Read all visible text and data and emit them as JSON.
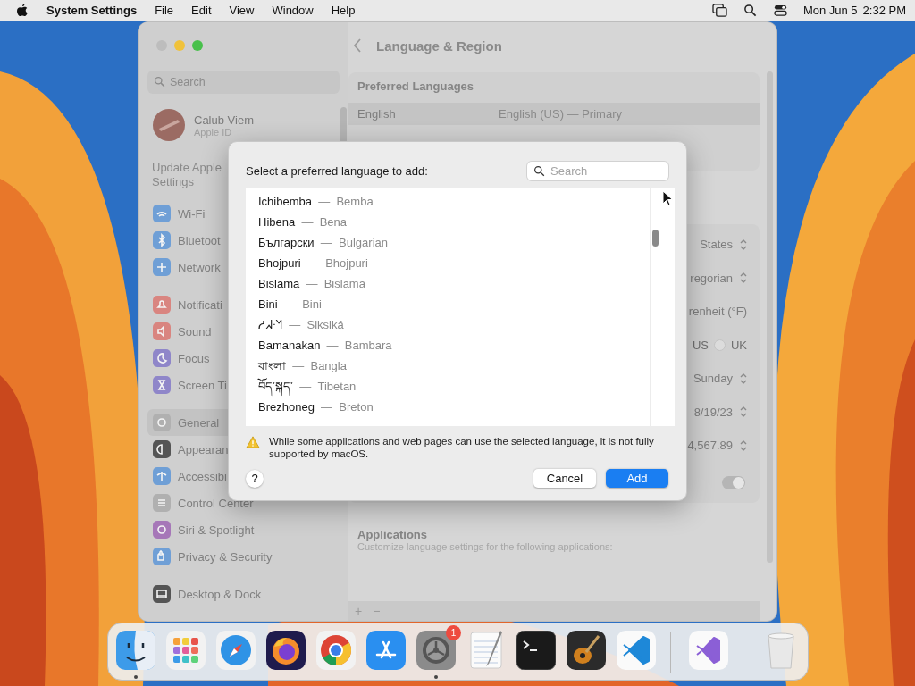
{
  "menu_bar": {
    "app": "System Settings",
    "menus": [
      "File",
      "Edit",
      "View",
      "Window",
      "Help"
    ],
    "date": "Mon Jun 5",
    "time": "2:32 PM"
  },
  "window": {
    "title": "Language & Region",
    "sidebar": {
      "search": {
        "placeholder": "Search"
      },
      "account": {
        "name": "Calub Viem",
        "subtitle": "Apple ID"
      },
      "notice": [
        "Update Apple",
        "Settings"
      ],
      "groups": [
        [
          {
            "label": "Wi-Fi",
            "color": "#6f9fd6",
            "selected": false
          },
          {
            "label": "Bluetoot",
            "color": "#6f9fd6",
            "selected": false
          },
          {
            "label": "Network",
            "color": "#6f9fd6",
            "selected": false
          }
        ],
        [
          {
            "label": "Notificati",
            "color": "#d98580",
            "selected": false
          },
          {
            "label": "Sound",
            "color": "#d98580",
            "selected": false
          },
          {
            "label": "Focus",
            "color": "#8f86c9",
            "selected": false
          },
          {
            "label": "Screen Ti",
            "color": "#8f86c9",
            "selected": false
          }
        ],
        [
          {
            "label": "General",
            "color": "#b0b0b0",
            "selected": true
          },
          {
            "label": "Appearan",
            "color": "#555555",
            "selected": false
          },
          {
            "label": "Accessibi",
            "color": "#6f9fd6",
            "selected": false
          },
          {
            "label": "Control Center",
            "color": "#b0b0b0",
            "selected": false
          },
          {
            "label": "Siri & Spotlight",
            "color": "#a677b8",
            "selected": false
          },
          {
            "label": "Privacy & Security",
            "color": "#6f9fd6",
            "selected": false
          }
        ],
        [
          {
            "label": "Desktop & Dock",
            "color": "#555555",
            "selected": false
          }
        ]
      ]
    },
    "preferred_languages": {
      "heading": "Preferred Languages",
      "rows": [
        {
          "language": "English",
          "detail": "English (US) — Primary",
          "selected": true
        }
      ]
    },
    "region_settings": [
      {
        "kind": "popup",
        "value": "States"
      },
      {
        "kind": "popup",
        "value": "regorian"
      },
      {
        "kind": "text",
        "value": "renheit (°F)"
      },
      {
        "kind": "radio",
        "options": [
          {
            "label": "US"
          },
          {
            "label": "UK",
            "selected": false
          }
        ]
      },
      {
        "kind": "popup",
        "value": "Sunday"
      },
      {
        "kind": "popup",
        "value": "8/19/23"
      },
      {
        "kind": "popup",
        "value": "4,567.89"
      },
      {
        "kind": "toggle",
        "on": true
      }
    ],
    "applications": {
      "heading": "Applications",
      "subtitle": "Customize language settings for the following applications:"
    },
    "list_buttons": [
      "+",
      "−"
    ]
  },
  "dialog": {
    "title": "Select a preferred language to add:",
    "search": {
      "placeholder": "Search"
    },
    "languages": [
      {
        "native": "Ichibemba",
        "english": "Bemba",
        "selected": false
      },
      {
        "native": "Hibena",
        "english": "Bena",
        "selected": false
      },
      {
        "native": "Български",
        "english": "Bulgarian",
        "selected": false
      },
      {
        "native": "Bhojpuri",
        "english": "Bhojpuri",
        "selected": false
      },
      {
        "native": "Bislama",
        "english": "Bislama",
        "selected": false
      },
      {
        "native": "Bini",
        "english": "Bini",
        "selected": false
      },
      {
        "native": "ᓱᖽᐧᖿ",
        "english": "Siksiká",
        "selected": false
      },
      {
        "native": "Bamanakan",
        "english": "Bambara",
        "selected": false
      },
      {
        "native": "বাংলা",
        "english": "Bangla",
        "selected": false
      },
      {
        "native": "བོད་སྐད་",
        "english": "Tibetan",
        "selected": false
      },
      {
        "native": "Brezhoneg",
        "english": "Breton",
        "selected": false
      }
    ],
    "separator": "—",
    "warning": "While some applications and web pages can use the selected language, it is not fully supported by macOS.",
    "help": "?",
    "buttons": [
      {
        "label": "Cancel",
        "kind": "secondary"
      },
      {
        "label": "Add",
        "kind": "primary"
      }
    ]
  },
  "dock": [
    {
      "kind": "finder",
      "running": true
    },
    {
      "kind": "launchpad"
    },
    {
      "kind": "safari"
    },
    {
      "kind": "firefox"
    },
    {
      "kind": "chrome"
    },
    {
      "kind": "appstore"
    },
    {
      "kind": "settings",
      "running": true,
      "badge": "1"
    },
    {
      "kind": "textedit"
    },
    {
      "kind": "terminal"
    },
    {
      "kind": "guitar"
    },
    {
      "kind": "vscode"
    },
    {
      "kind": "divider"
    },
    {
      "kind": "vstudio"
    },
    {
      "kind": "divider"
    },
    {
      "kind": "trash"
    }
  ]
}
